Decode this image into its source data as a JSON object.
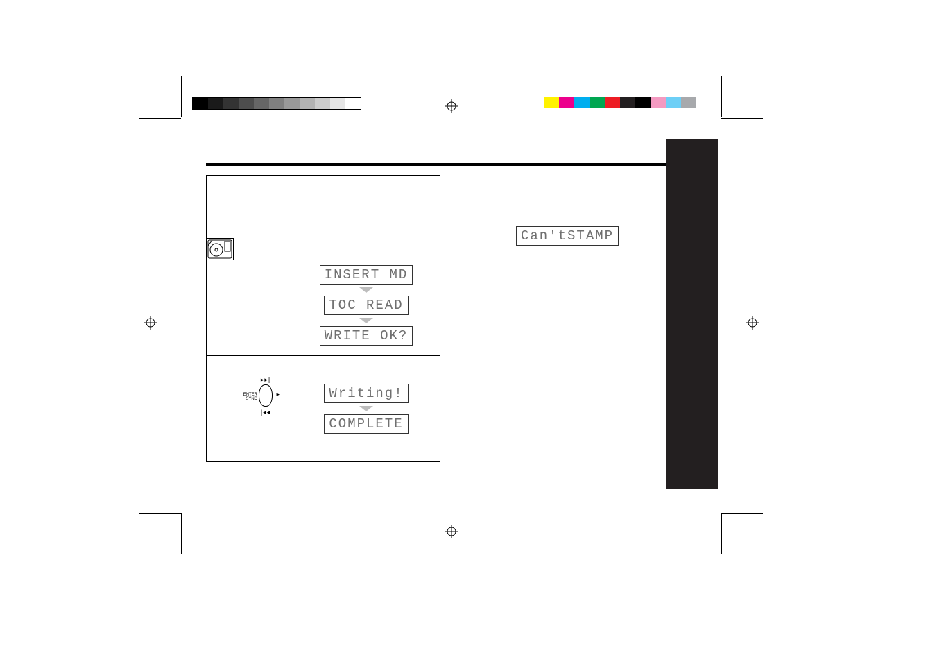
{
  "print_marks": {
    "grayscale_steps": 11,
    "color_swatches": [
      "#fff200",
      "#ec008c",
      "#00aeef",
      "#00a651",
      "#ed1c24",
      "#231f20",
      "#f49ac1",
      "#6dcff6",
      "#a7a9ac"
    ]
  },
  "page": {
    "error_display": "Can'tSTAMP",
    "steps": {
      "middle": {
        "lcd1": "INSERT MD",
        "lcd2": "TOC READ",
        "lcd3": "WRITE OK?"
      },
      "bottom": {
        "jog_label": "ENTER\nSYNC",
        "lcd1": "Writing!",
        "lcd2": "COMPLETE"
      }
    }
  }
}
